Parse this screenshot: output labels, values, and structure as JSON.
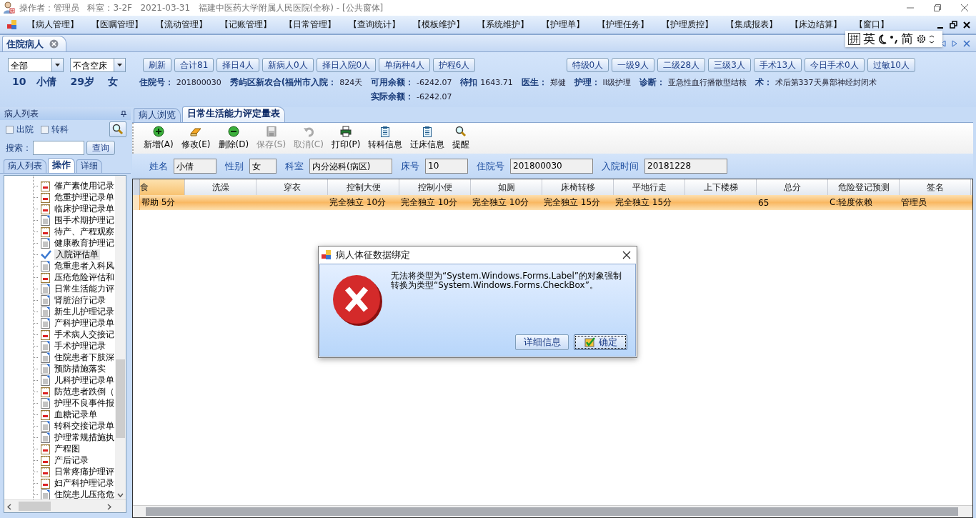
{
  "window": {
    "title": "操作者：管理员   科室：3-2F   2021-03-31   福建中医药大学附属人民医院(全称) - [公共窗体]"
  },
  "menu": [
    "【病人管理】",
    "【医嘱管理】",
    "【流动管理】",
    "【记账管理】",
    "【日常管理】",
    "【查询统计】",
    "【模板维护】",
    "【系统维护】",
    "【护理单】",
    "【护理任务】",
    "【护理质控】",
    "【集成报表】",
    "【床边结算】",
    "【窗口】"
  ],
  "ime_bar": {
    "mode": "拼",
    "language": "英",
    "script": "简"
  },
  "doc_tabs": [
    {
      "label": "住院病人",
      "selected": true
    }
  ],
  "filters": [
    "全部",
    "不含空床"
  ],
  "quick_buttons": [
    "刷新",
    "合计81",
    "择日4人",
    "新病人0人",
    "择日入院0人",
    "单病种4人",
    "护程6人"
  ],
  "level_buttons": [
    "特级0人",
    "一级9人",
    "二级28人",
    "三级3人",
    "手术13人",
    "今日手术0人",
    "过敏10人"
  ],
  "patient": {
    "summary": [
      "10",
      "小倩",
      "29岁",
      "女"
    ],
    "fields": [
      {
        "label": "住院号：",
        "value": "201800030"
      },
      {
        "label": "秀屿区新农合(福州市入院：",
        "value": "824天"
      },
      {
        "label": "可用余额：",
        "value": "-6242.07"
      },
      {
        "label": "待扣",
        "value": "1643.71"
      },
      {
        "label": "医生：",
        "value": "郑健"
      },
      {
        "label": "护理：",
        "value": "II级护理"
      },
      {
        "label": "诊断：",
        "value": "亚急性血行播散型结核"
      },
      {
        "label": "术：",
        "value": "术后第337天鼻部神经封闭术"
      }
    ],
    "balance": {
      "label": "实际余额：",
      "value": "-6242.07"
    }
  },
  "sidebar": {
    "title": "病人列表",
    "checkboxes": [
      {
        "label": "出院",
        "checked": false
      },
      {
        "label": "转科",
        "checked": false
      }
    ],
    "search_label": "搜索：",
    "search_button": "查询",
    "tabs": [
      {
        "label": "病人列表",
        "selected": false
      },
      {
        "label": "操作",
        "selected": true
      },
      {
        "label": "详细",
        "selected": false
      }
    ],
    "tree": [
      {
        "label": "催产素使用记录",
        "kind": "form",
        "selected": false
      },
      {
        "label": "危重护理记录单",
        "kind": "form",
        "selected": false
      },
      {
        "label": "临床护理记录单",
        "kind": "form",
        "selected": false
      },
      {
        "label": "围手术期护理记",
        "kind": "doc",
        "selected": false
      },
      {
        "label": "待产、产程观察",
        "kind": "form",
        "selected": false
      },
      {
        "label": "健康教育护理记",
        "kind": "doc",
        "selected": false
      },
      {
        "label": "入院评估单",
        "kind": "check",
        "selected": true
      },
      {
        "label": "危重患者入科风",
        "kind": "doc",
        "selected": false
      },
      {
        "label": "压疮危险评估和",
        "kind": "form",
        "selected": false
      },
      {
        "label": "日常生活能力评",
        "kind": "doc",
        "selected": false
      },
      {
        "label": "肾脏治疗记录",
        "kind": "doc",
        "selected": false
      },
      {
        "label": "新生儿护理记录",
        "kind": "doc",
        "selected": false
      },
      {
        "label": "产科护理记录单",
        "kind": "doc",
        "selected": false
      },
      {
        "label": "手术病人交接记",
        "kind": "form",
        "selected": false
      },
      {
        "label": "手术护理记录",
        "kind": "doc",
        "selected": false
      },
      {
        "label": "住院患者下肢深",
        "kind": "doc",
        "selected": false
      },
      {
        "label": "预防措施落实",
        "kind": "doc",
        "selected": false
      },
      {
        "label": "儿科护理记录单",
        "kind": "doc",
        "selected": false
      },
      {
        "label": "防范患者跌倒（",
        "kind": "form",
        "selected": false
      },
      {
        "label": "护理不良事件报",
        "kind": "doc",
        "selected": false
      },
      {
        "label": "血糖记录单",
        "kind": "form",
        "selected": false
      },
      {
        "label": "转科交接记录单",
        "kind": "doc",
        "selected": false
      },
      {
        "label": "护理常规措施执",
        "kind": "doc",
        "selected": false
      },
      {
        "label": "产程图",
        "kind": "form",
        "selected": false
      },
      {
        "label": "产后记录",
        "kind": "form",
        "selected": false
      },
      {
        "label": "日常疼痛护理评",
        "kind": "form",
        "selected": false
      },
      {
        "label": "妇产科护理记录",
        "kind": "form",
        "selected": false
      },
      {
        "label": "住院患儿压疮危",
        "kind": "doc",
        "selected": false
      }
    ]
  },
  "content": {
    "tabs": [
      {
        "label": "病人浏览",
        "selected": false
      },
      {
        "label": "日常生活能力评定量表",
        "selected": true
      }
    ],
    "toolbar": [
      {
        "label": "新增(A)",
        "kind": "add",
        "disabled": false
      },
      {
        "label": "修改(E)",
        "kind": "edit",
        "disabled": false
      },
      {
        "label": "删除(D)",
        "kind": "delete",
        "disabled": false
      },
      {
        "label": "保存(S)",
        "kind": "save",
        "disabled": true
      },
      {
        "label": "取消(C)",
        "kind": "undo",
        "disabled": true
      },
      {
        "label": "打印(P)",
        "kind": "print",
        "disabled": false
      },
      {
        "label": "转科信息",
        "kind": "clipboard",
        "disabled": false
      },
      {
        "label": "迁床信息",
        "kind": "clipboard",
        "disabled": false
      },
      {
        "label": "提醒",
        "kind": "search",
        "disabled": false
      }
    ],
    "form": [
      {
        "label": "姓名",
        "value": "小倩"
      },
      {
        "label": "性别",
        "value": "女"
      },
      {
        "label": "科室",
        "value": "内分泌科(病区)"
      },
      {
        "label": "床号",
        "value": "10"
      },
      {
        "label": "住院号",
        "value": "201800030"
      },
      {
        "label": "入院时间",
        "value": "20181228"
      }
    ],
    "table": {
      "columns": [
        {
          "label": "食",
          "selected": true
        },
        {
          "label": "洗澡",
          "selected": false
        },
        {
          "label": "穿衣",
          "selected": false
        },
        {
          "label": "控制大便",
          "selected": false
        },
        {
          "label": "控制小便",
          "selected": false
        },
        {
          "label": "如厕",
          "selected": false
        },
        {
          "label": "床椅转移",
          "selected": false
        },
        {
          "label": "平地行走",
          "selected": false
        },
        {
          "label": "上下楼梯",
          "selected": false
        },
        {
          "label": "总分",
          "selected": false
        },
        {
          "label": "危险登记预测",
          "selected": false
        },
        {
          "label": "签名",
          "selected": false
        }
      ],
      "rows": [
        {
          "selected": true,
          "cells": [
            "帮助 5分",
            "",
            "",
            "完全独立 10分",
            "完全独立 10分",
            "完全独立 10分",
            "完全独立 15分",
            "完全独立 15分",
            "",
            "65",
            "C:轻度依赖",
            "管理员"
          ]
        }
      ]
    }
  },
  "dialog": {
    "title": "病人体征数据绑定",
    "message": "无法将类型为“System.Windows.Forms.Label”的对象强制转换为类型“System.Windows.Forms.CheckBox”。",
    "buttons": [
      {
        "label": "详细信息",
        "default": false
      },
      {
        "label": "确定",
        "default": true
      }
    ]
  }
}
